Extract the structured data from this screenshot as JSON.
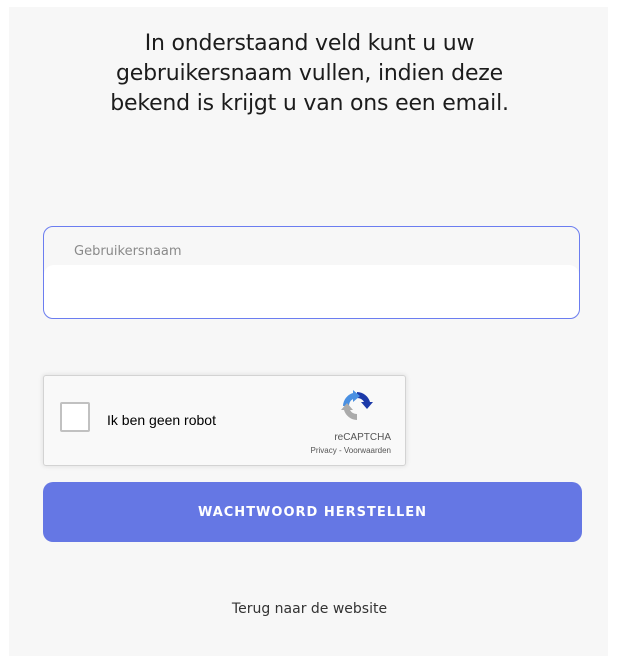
{
  "heading": {
    "line1": "In onderstaand veld kunt u uw",
    "line2": "gebruikersnaam vullen, indien deze",
    "line3": "bekend is krijgt u van ons een email."
  },
  "username_field": {
    "label": "Gebruikersnaam",
    "value": "",
    "accent_color": "#6b7df0"
  },
  "captcha": {
    "checkbox_label": "Ik ben geen robot",
    "brand": "reCAPTCHA",
    "links": "Privacy - Voorwaarden",
    "icon": "recaptcha-logo-icon",
    "checked": false
  },
  "submit_button": {
    "label": "WACHTWOORD HERSTELLEN",
    "color": "#6577e4"
  },
  "back_link": {
    "label": "Terug naar de website"
  }
}
